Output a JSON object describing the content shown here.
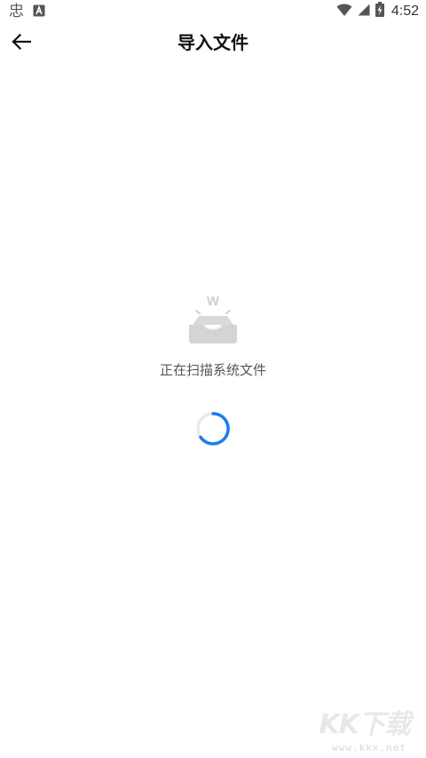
{
  "status_bar": {
    "left_app_glyph": "忠",
    "time": "4:52",
    "icons": [
      "notification-a-icon",
      "wifi-icon",
      "cell-signal-icon",
      "battery-charging-icon"
    ]
  },
  "app_bar": {
    "title": "导入文件",
    "back_icon": "arrow-left-icon"
  },
  "scan_state": {
    "illustration_icon": "inbox-document-icon",
    "message": "正在扫描系统文件",
    "spinner_color": "#1a7ee6"
  },
  "watermark": {
    "logo": "KK下载",
    "url": "www.kkx.net"
  }
}
